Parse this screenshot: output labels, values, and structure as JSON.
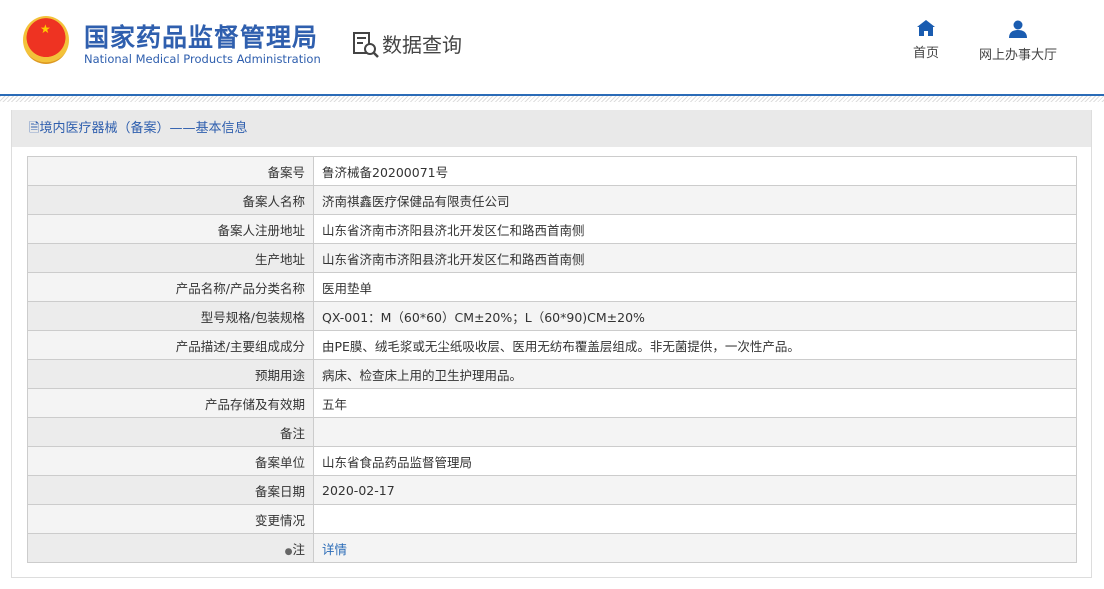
{
  "header": {
    "title_cn": "国家药品监督管理局",
    "title_en": "National Medical Products Administration",
    "section": "数据查询",
    "nav": [
      {
        "label": "首页"
      },
      {
        "label": "网上办事大厅"
      }
    ]
  },
  "panel": {
    "title": "境内医疗器械（备案）——基本信息"
  },
  "rows": [
    {
      "label": "备案号",
      "value": "鲁济械备20200071号"
    },
    {
      "label": "备案人名称",
      "value": "济南祺鑫医疗保健品有限责任公司"
    },
    {
      "label": "备案人注册地址",
      "value": "山东省济南市济阳县济北开发区仁和路西首南侧"
    },
    {
      "label": "生产地址",
      "value": "山东省济南市济阳县济北开发区仁和路西首南侧"
    },
    {
      "label": "产品名称/产品分类名称",
      "value": "医用垫单"
    },
    {
      "label": "型号规格/包装规格",
      "value": "QX-001：M（60*60）CM±20%；L（60*90)CM±20%"
    },
    {
      "label": "产品描述/主要组成成分",
      "value": "由PE膜、绒毛浆或无尘纸吸收层、医用无纺布覆盖层组成。非无菌提供，一次性产品。"
    },
    {
      "label": "预期用途",
      "value": "病床、检查床上用的卫生护理用品。"
    },
    {
      "label": "产品存储及有效期",
      "value": "五年"
    },
    {
      "label": "备注",
      "value": ""
    },
    {
      "label": "备案单位",
      "value": "山东省食品药品监督管理局"
    },
    {
      "label": "备案日期",
      "value": "2020-02-17"
    },
    {
      "label": "变更情况",
      "value": ""
    },
    {
      "label": "注",
      "value": "详情"
    }
  ]
}
